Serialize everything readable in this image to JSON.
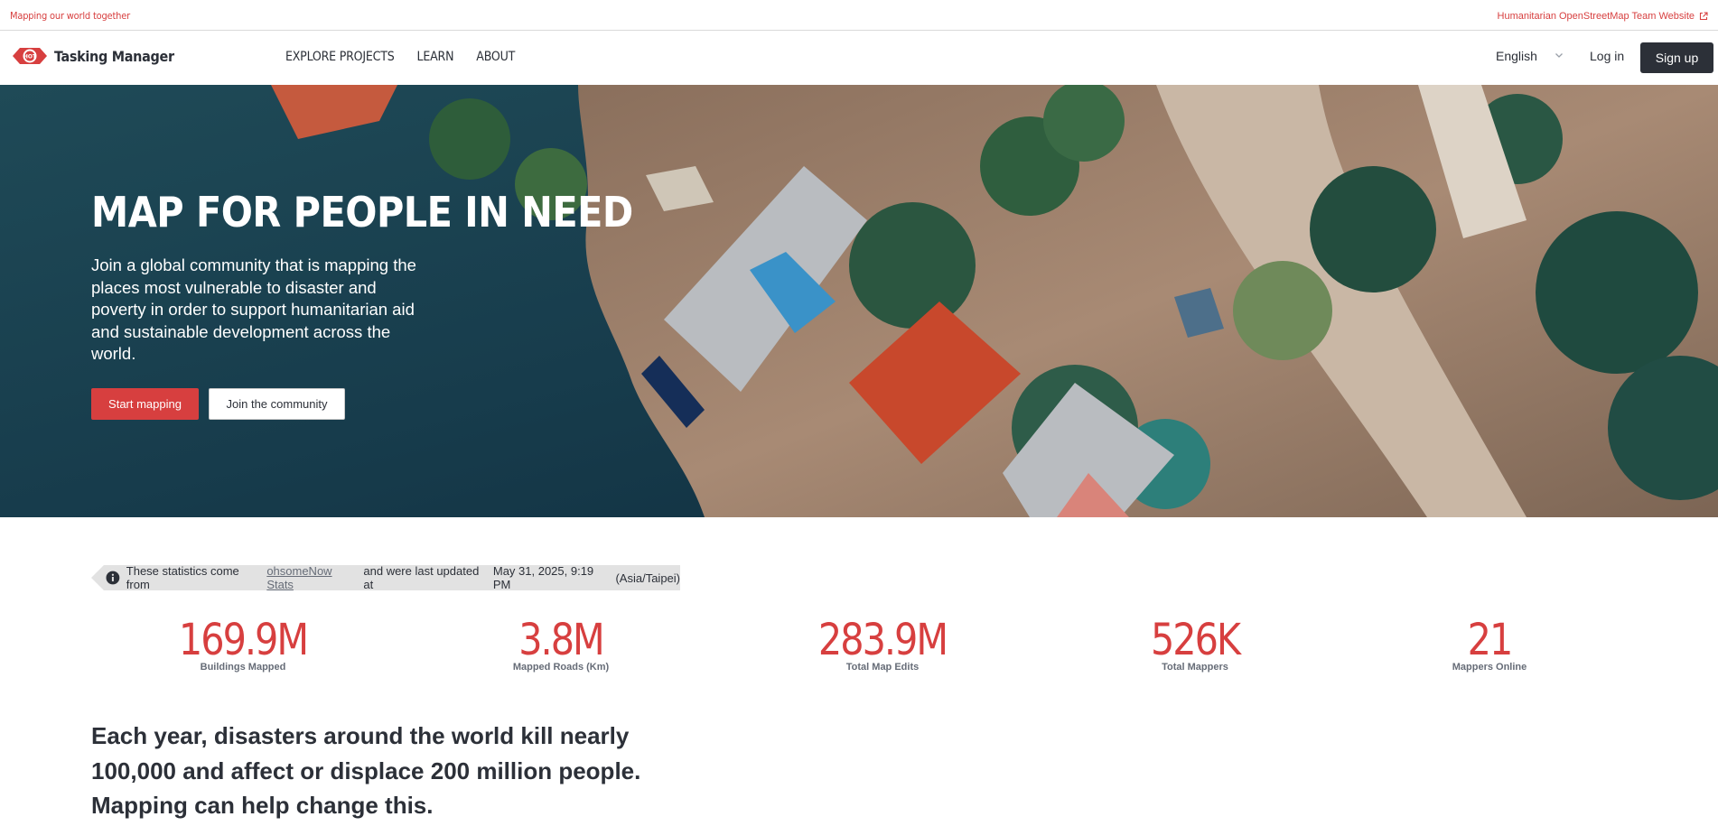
{
  "topbar": {
    "tagline": "Mapping our world together",
    "hot_link": "Humanitarian OpenStreetMap Team Website",
    "hot_link_icon": "external-link-icon"
  },
  "nav": {
    "brand": "Tasking Manager",
    "logo_text": "HOT",
    "items": [
      {
        "label": "EXPLORE PROJECTS"
      },
      {
        "label": "LEARN"
      },
      {
        "label": "ABOUT"
      }
    ],
    "language": "English",
    "login": "Log in",
    "signup": "Sign up"
  },
  "hero": {
    "title": "MAP FOR PEOPLE IN NEED",
    "subtitle": "Join a global community that is mapping the places most vulnerable to disaster and poverty in order to support humanitarian aid and sustainable development across the world.",
    "start_button": "Start mapping",
    "join_button": "Join the community"
  },
  "stats_note": {
    "prefix": "These statistics come from",
    "link": "ohsomeNow Stats",
    "middle": "and were last updated at",
    "date": "May 31, 2025, 9:19 PM",
    "timezone": "(Asia/Taipei)"
  },
  "stats": [
    {
      "value": "169.9M",
      "label": "Buildings Mapped"
    },
    {
      "value": "3.8M",
      "label": "Mapped Roads (Km)"
    },
    {
      "value": "283.9M",
      "label": "Total Map Edits"
    },
    {
      "value": "526K",
      "label": "Total Mappers"
    },
    {
      "value": "21",
      "label": "Mappers Online"
    }
  ],
  "mission": {
    "text": "Each year, disasters around the world kill nearly 100,000 and affect or displace 200 million people. Mapping can help change this."
  },
  "colors": {
    "accent": "#d73f3f",
    "dark": "#2c3038",
    "muted": "#666c77"
  }
}
